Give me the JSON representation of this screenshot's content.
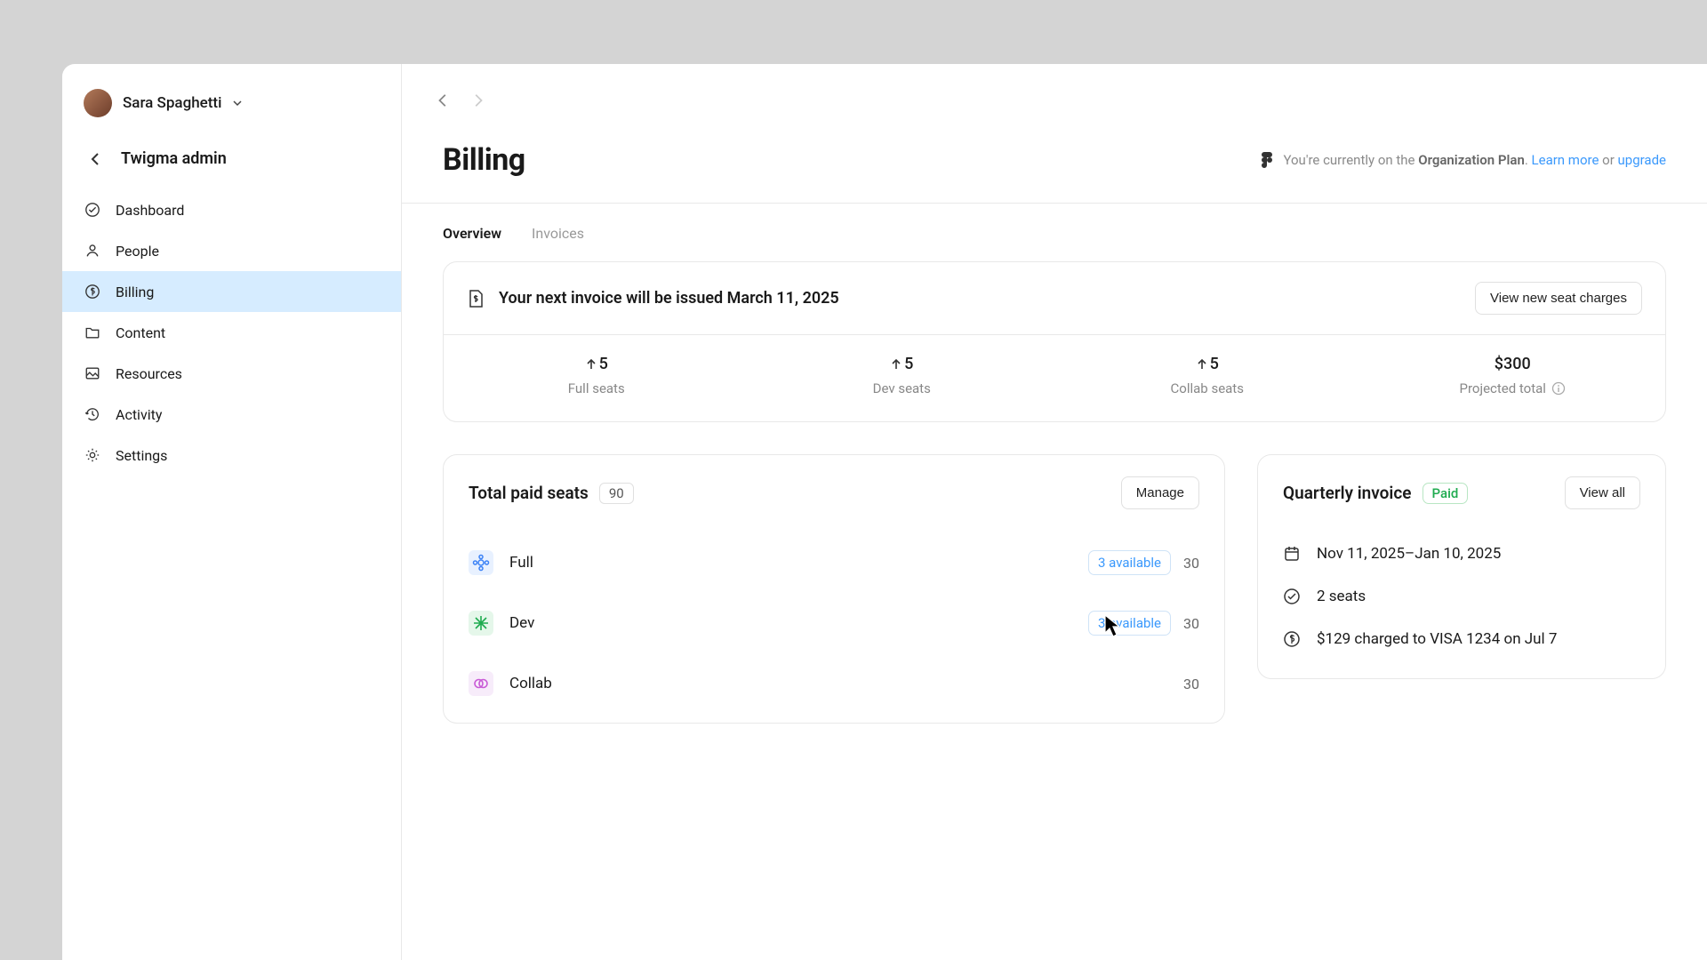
{
  "user": {
    "name": "Sara Spaghetti"
  },
  "admin_title": "Twigma admin",
  "nav": {
    "dashboard": "Dashboard",
    "people": "People",
    "billing": "Billing",
    "content": "Content",
    "resources": "Resources",
    "activity": "Activity",
    "settings": "Settings"
  },
  "page_title": "Billing",
  "plan_banner": {
    "prefix": "You're currently on the ",
    "plan": "Organization Plan",
    "learn_more": "Learn more",
    "or": " or ",
    "upgrade": "upgrade"
  },
  "tabs": {
    "overview": "Overview",
    "invoices": "Invoices"
  },
  "next_invoice": {
    "title": "Your next invoice will be issued March 11, 2025",
    "button": "View new seat charges",
    "stats": {
      "full": {
        "delta": "5",
        "label": "Full seats"
      },
      "dev": {
        "delta": "5",
        "label": "Dev seats"
      },
      "collab": {
        "delta": "5",
        "label": "Collab seats"
      },
      "total": {
        "value": "$300",
        "label": "Projected total"
      }
    }
  },
  "seats": {
    "title": "Total paid seats",
    "total": "90",
    "manage": "Manage",
    "rows": {
      "full": {
        "name": "Full",
        "available": "3 available",
        "count": "30"
      },
      "dev": {
        "name": "Dev",
        "available": "3 available",
        "count": "30"
      },
      "collab": {
        "name": "Collab",
        "count": "30"
      }
    }
  },
  "quarterly": {
    "title": "Quarterly invoice",
    "status": "Paid",
    "view_all": "View all",
    "period": "Nov 11, 2025–Jan 10, 2025",
    "seats": "2 seats",
    "charge": "$129 charged to VISA 1234 on Jul 7"
  }
}
